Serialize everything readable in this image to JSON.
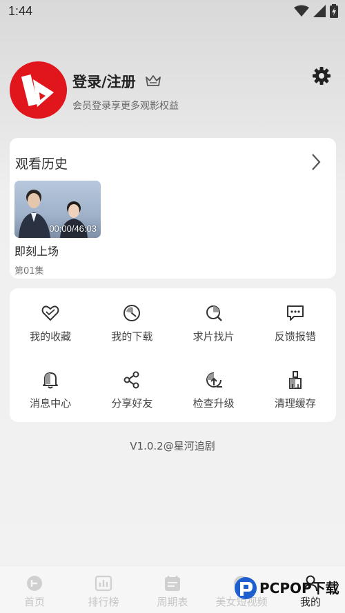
{
  "status_bar": {
    "time": "1:44"
  },
  "profile": {
    "title": "登录/注册",
    "subtitle": "会员登录享更多观影权益"
  },
  "history": {
    "title": "观看历史",
    "items": [
      {
        "name": "即刻上场",
        "episode": "第01集",
        "progress": "00:00/46:03"
      }
    ]
  },
  "features": [
    {
      "label": "我的收藏",
      "icon": "heart-icon"
    },
    {
      "label": "我的下载",
      "icon": "download-icon"
    },
    {
      "label": "求片找片",
      "icon": "search-film-icon"
    },
    {
      "label": "反馈报错",
      "icon": "feedback-icon"
    },
    {
      "label": "消息中心",
      "icon": "bell-icon"
    },
    {
      "label": "分享好友",
      "icon": "share-icon"
    },
    {
      "label": "检查升级",
      "icon": "upgrade-icon"
    },
    {
      "label": "清理缓存",
      "icon": "broom-icon"
    }
  ],
  "version": "V1.0.2@星河追剧",
  "nav": [
    {
      "label": "首页",
      "icon": "home-icon"
    },
    {
      "label": "排行榜",
      "icon": "ranking-icon"
    },
    {
      "label": "周期表",
      "icon": "calendar-icon"
    },
    {
      "label": "美女短视频",
      "icon": "video-icon"
    },
    {
      "label": "我的",
      "icon": "profile-icon"
    }
  ],
  "watermark": "PCPOP下载",
  "colors": {
    "brand_red": "#e0161c",
    "card_bg": "#ffffff",
    "inactive_nav": "#c6c6c6"
  }
}
